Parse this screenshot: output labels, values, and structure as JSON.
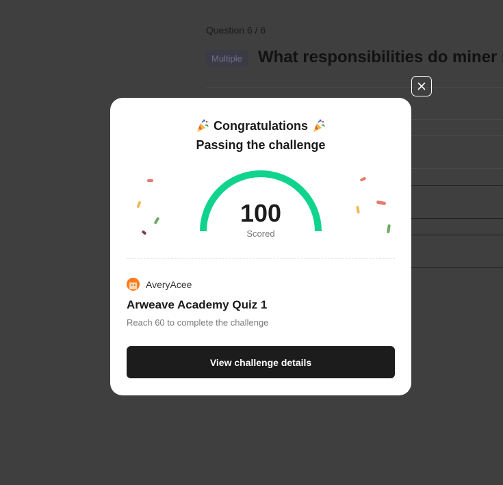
{
  "background": {
    "question_counter": "Question 6 / 6",
    "tag": "Multiple",
    "question_title": "What responsibilities do miner n"
  },
  "modal": {
    "heading_line1": "Congratulations",
    "heading_line2": "Passing the challenge",
    "party_icon_left": "party-popper-icon",
    "party_icon_right": "party-popper-icon",
    "score": "100",
    "score_fraction": 1.0,
    "score_label": "Scored",
    "gauge_color": "#10d48e",
    "author": "AveryAcee",
    "quiz_title": "Arweave Academy Quiz 1",
    "quiz_subtitle": "Reach 60 to complete the challenge",
    "cta_label": "View challenge details",
    "close_icon": "close-icon"
  }
}
